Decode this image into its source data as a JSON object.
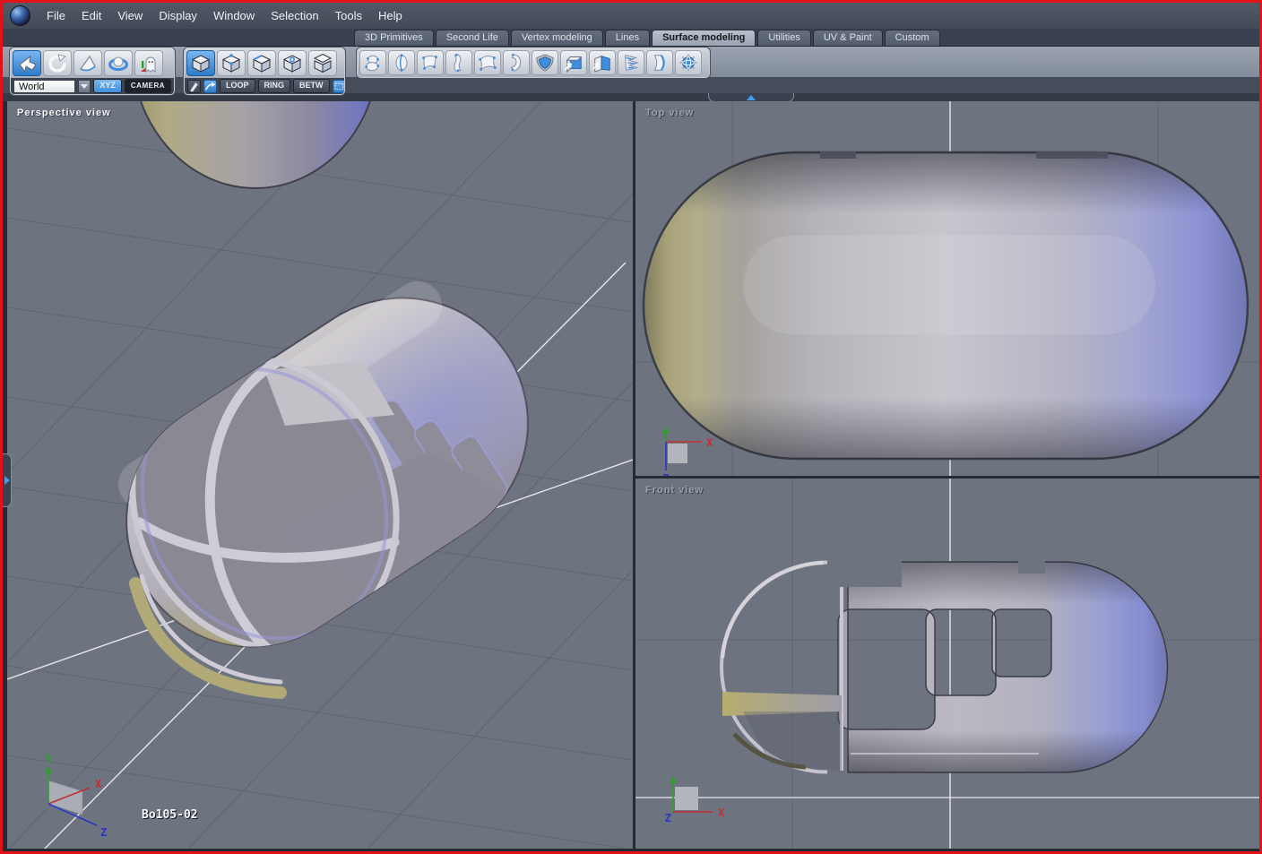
{
  "app": {
    "window_border_color": "#e31219",
    "logo": "blue-sphere-app-logo"
  },
  "menubar": {
    "items": [
      "File",
      "Edit",
      "View",
      "Display",
      "Window",
      "Selection",
      "Tools",
      "Help"
    ]
  },
  "tabs": {
    "items": [
      {
        "label": "3D Primitives",
        "active": false
      },
      {
        "label": "Second Life",
        "active": false
      },
      {
        "label": "Vertex modeling",
        "active": false
      },
      {
        "label": "Lines",
        "active": false
      },
      {
        "label": "Surface modeling",
        "active": true
      },
      {
        "label": "Utilities",
        "active": false
      },
      {
        "label": "UV & Paint",
        "active": false
      },
      {
        "label": "Custom",
        "active": false
      }
    ]
  },
  "toolbar": {
    "selection_group": {
      "tools": [
        "select-arrow",
        "rotate-arrow",
        "face-pick",
        "ring-sphere",
        "ghost"
      ],
      "selected_index": 0,
      "world_label": "World",
      "xyz_label": "XYZ",
      "camera_label": "CAMERA"
    },
    "mode_group": {
      "tools": [
        "cube-object-mode",
        "cube-points-mode",
        "cube-edges-mode",
        "cube-faces-mode",
        "cube-uv-mode"
      ],
      "selected_index": 0,
      "loop_label": "LOOP",
      "ring_label": "RING",
      "betw_label": "BETW",
      "extra_tools": [
        "pen",
        "blue-curved-arrow",
        "dashed-rect-select",
        "ellipse-select"
      ]
    },
    "surface_group": {
      "tools": [
        "vase-sweep",
        "profile-oval",
        "ruled-surface",
        "curved-pillar",
        "coons-patch",
        "bent-tube",
        "shield-surface",
        "extrude-box",
        "fold-surface",
        "zigzag-surface",
        "thickness-slab",
        "caged-sphere"
      ]
    }
  },
  "viewports": {
    "perspective": {
      "label": "Perspective view",
      "object_name": "Bo105-02",
      "axis": {
        "x": "X",
        "y": "Y",
        "z": "Z"
      }
    },
    "top": {
      "label": "Top view",
      "axis": {
        "x": "X",
        "z": "Z"
      }
    },
    "front": {
      "label": "Front view",
      "axis": {
        "x": "X",
        "z": "Z"
      }
    }
  },
  "colors": {
    "accent_blue": "#3f8edd",
    "viewport_background": "#6e7380",
    "axis_x": "#c03030",
    "axis_y": "#2f9e2f",
    "axis_z": "#2b35c8"
  }
}
